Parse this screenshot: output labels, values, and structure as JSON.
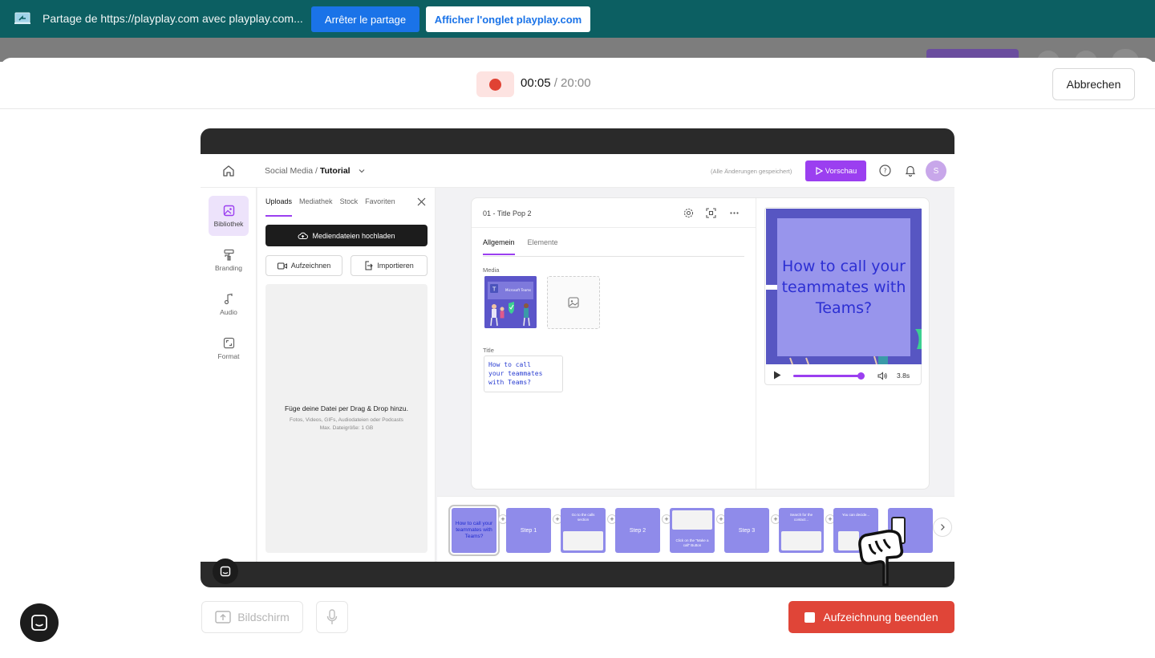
{
  "share_bar": {
    "text": "Partage de https://playplay.com avec playplay.com...",
    "stop_label": "Arrêter le partage",
    "show_tab_label": "Afficher l'onglet playplay.com",
    "icon": "screen-share-icon"
  },
  "recorder": {
    "elapsed": "00:05",
    "limit": "/ 20:00",
    "cancel_label": "Abbrechen",
    "screen_label": "Bildschirm",
    "end_label": "Aufzeichnung beenden",
    "colors": {
      "record": "#e04234",
      "end_button": "#e04538"
    }
  },
  "app": {
    "breadcrumb_prefix": "Social Media / ",
    "breadcrumb_current": "Tutorial",
    "saved_note": "(Alle Änderungen gespeichert)",
    "preview_label": "Vorschau",
    "avatar_initial": "S",
    "accent": "#9b3ff0",
    "rail": [
      {
        "label": "Bibliothek",
        "icon": "library-icon",
        "active": true
      },
      {
        "label": "Branding",
        "icon": "paint-roller-icon"
      },
      {
        "label": "Audio",
        "icon": "music-note-icon"
      },
      {
        "label": "Format",
        "icon": "format-icon"
      }
    ],
    "uploads": {
      "tabs": [
        "Uploads",
        "Mediathek",
        "Stock",
        "Favoriten"
      ],
      "upload_button": "Mediendateien hochladen",
      "record_button": "Aufzeichnen",
      "import_button": "Importieren",
      "drop_title": "Füge deine Datei per Drag & Drop hinzu.",
      "drop_sub1": "Fotos, Videos, GIFs, Audiodateien oder Podcasts",
      "drop_sub2": "Max. Dateigröße: 1 GB"
    },
    "editor": {
      "scene_title": "01 - Title Pop 2",
      "tabs": [
        "Allgemein",
        "Elemente"
      ],
      "media_label": "Media",
      "media_thumb_caption": "Microsoft Teams",
      "title_label": "Title",
      "title_value_lines": [
        "How to call",
        "your teammates",
        "with Teams?"
      ]
    },
    "player": {
      "headline": "How to call your teammates with Teams?",
      "duration": "3.8s",
      "progress": 0.95
    },
    "timeline": [
      {
        "label": "How to call your teammates with Teams?"
      },
      {
        "label": "Step 1"
      },
      {
        "label": "Go to the calls section"
      },
      {
        "label": "Step 2"
      },
      {
        "label": "Click on the \"Make a call\" Button"
      },
      {
        "label": "Step 3"
      },
      {
        "label": "Search for the contact..."
      },
      {
        "label": "You can decide..."
      },
      {
        "label": ""
      }
    ]
  }
}
